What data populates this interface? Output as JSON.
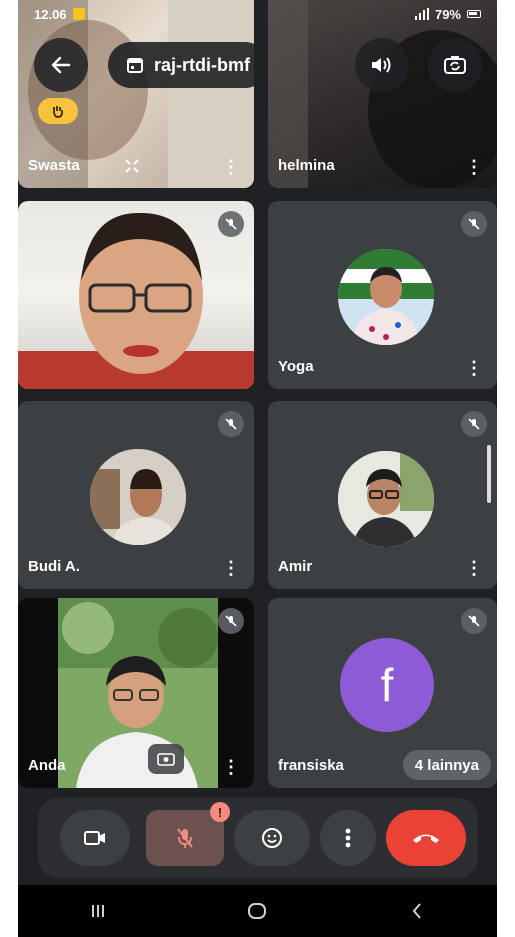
{
  "status_bar": {
    "time": "12.06",
    "battery": "79%"
  },
  "top_bar": {
    "meeting_code": "raj-rtdi-bmf",
    "back_icon": "arrow-left-icon",
    "calendar_icon": "calendar-icon",
    "speaker_icon": "speaker-icon",
    "switch_camera_icon": "switch-camera-icon"
  },
  "participants": [
    {
      "name": "Swasta"
    },
    {
      "name": "helmina"
    },
    {
      "name": "Yoga"
    },
    {
      "name": "Budi A."
    },
    {
      "name": "Amir"
    },
    {
      "name": "Anda"
    },
    {
      "name": "fransiska",
      "initial": "f"
    }
  ],
  "more_participants": "4 lainnya",
  "controls": {
    "mic_alert": "!"
  },
  "colors": {
    "background": "#202124",
    "tile": "#3c4043",
    "end_call": "#ea4335",
    "fransiska_avatar": "#8e5bd6",
    "hand_badge": "#f9c23c"
  }
}
